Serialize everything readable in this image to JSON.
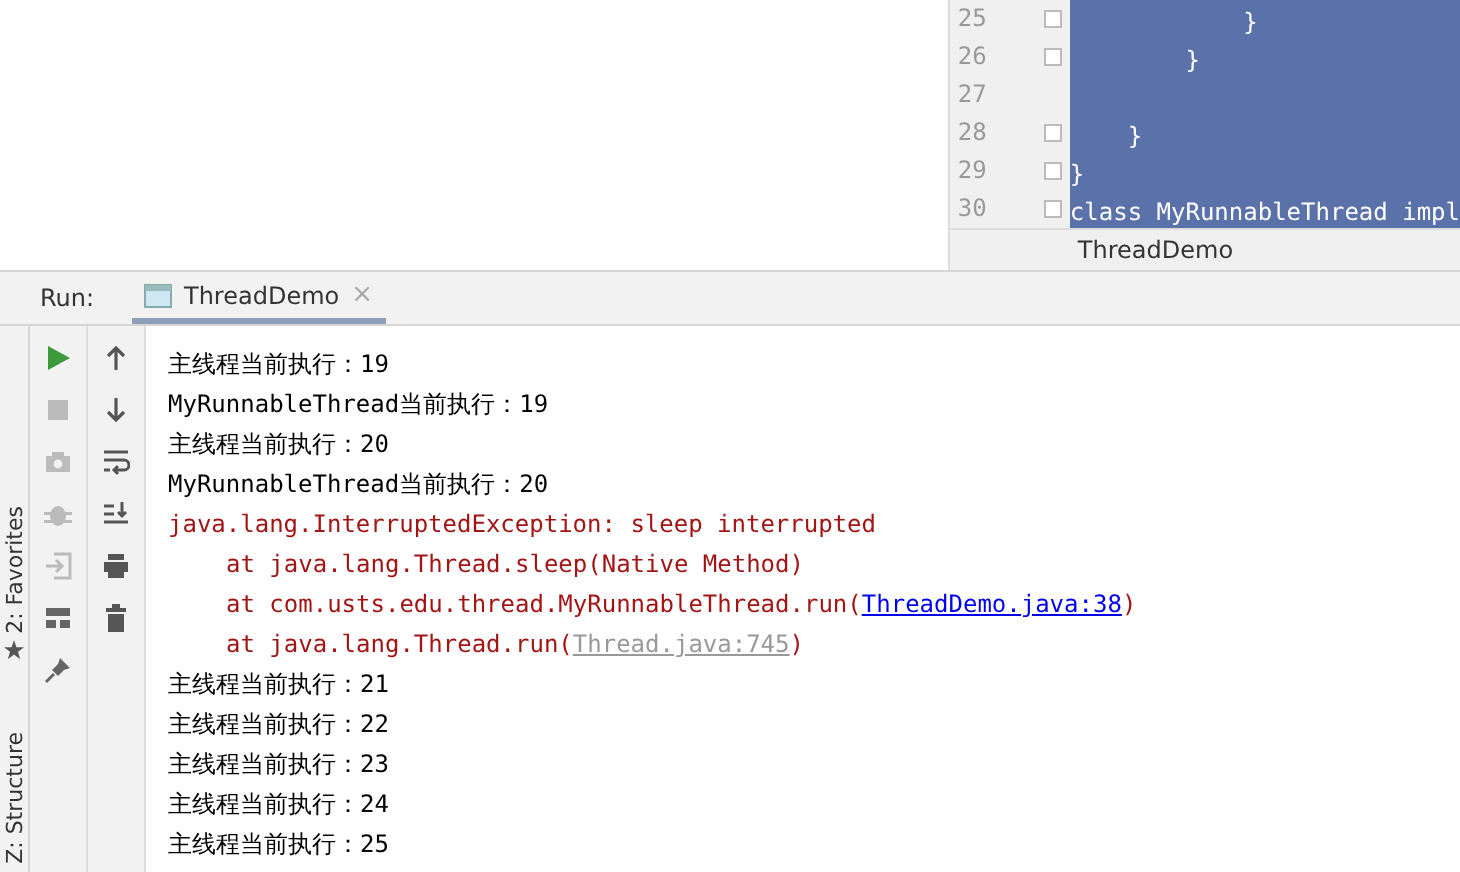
{
  "editor": {
    "lines": [
      {
        "number": "25",
        "text": "            }"
      },
      {
        "number": "26",
        "text": "        }"
      },
      {
        "number": "27"
      },
      {
        "number": "28",
        "text": "    }"
      },
      {
        "number": "29",
        "text": "}"
      },
      {
        "number": "30",
        "text": "class MyRunnableThread impl"
      }
    ],
    "breadcrumb": "ThreadDemo"
  },
  "run_bar": {
    "label": "Run:",
    "tabs": [
      {
        "title": "ThreadDemo",
        "close": "×",
        "selected": true
      }
    ]
  },
  "side_labels": [
    "2: Favorites",
    "Z: Structure"
  ],
  "toolbar_left": [
    {
      "kind": "run",
      "disabled": false
    },
    {
      "kind": "stop",
      "disabled": true
    },
    {
      "kind": "camera",
      "disabled": true
    },
    {
      "kind": "bug",
      "disabled": true
    },
    {
      "kind": "enter",
      "disabled": true
    },
    {
      "kind": "layout",
      "disabled": false
    },
    {
      "kind": "pin",
      "disabled": false
    }
  ],
  "toolbar_right": [
    {
      "kind": "up"
    },
    {
      "kind": "down"
    },
    {
      "kind": "wrap"
    },
    {
      "kind": "scroll-end"
    },
    {
      "kind": "print"
    },
    {
      "kind": "trash"
    }
  ],
  "console": [
    {
      "kind": "out",
      "text": "主线程当前执行：19"
    },
    {
      "kind": "out",
      "text": "MyRunnableThread当前执行：19"
    },
    {
      "kind": "out",
      "text": "主线程当前执行：20"
    },
    {
      "kind": "out",
      "text": "MyRunnableThread当前执行：20"
    },
    {
      "kind": "error",
      "text": "java.lang.InterruptedException: sleep interrupted"
    },
    {
      "kind": "trace",
      "text": "at java.lang.Thread.sleep(Native Method)"
    },
    {
      "kind": "trace",
      "text": "at com.usts.edu.thread.MyRunnableThread.run(",
      "link": {
        "text": "ThreadDemo.java:38",
        "color": "#0000ee"
      },
      "after": ")"
    },
    {
      "kind": "trace",
      "text": "at java.lang.Thread.run(",
      "link": {
        "text": "Thread.java:745",
        "color": "#999999"
      },
      "after": ")"
    },
    {
      "kind": "out",
      "text": "主线程当前执行：21"
    },
    {
      "kind": "out",
      "text": "主线程当前执行：22"
    },
    {
      "kind": "out",
      "text": "主线程当前执行：23"
    },
    {
      "kind": "out",
      "text": "主线程当前执行：24"
    },
    {
      "kind": "out",
      "text": "主线程当前执行：25"
    }
  ]
}
